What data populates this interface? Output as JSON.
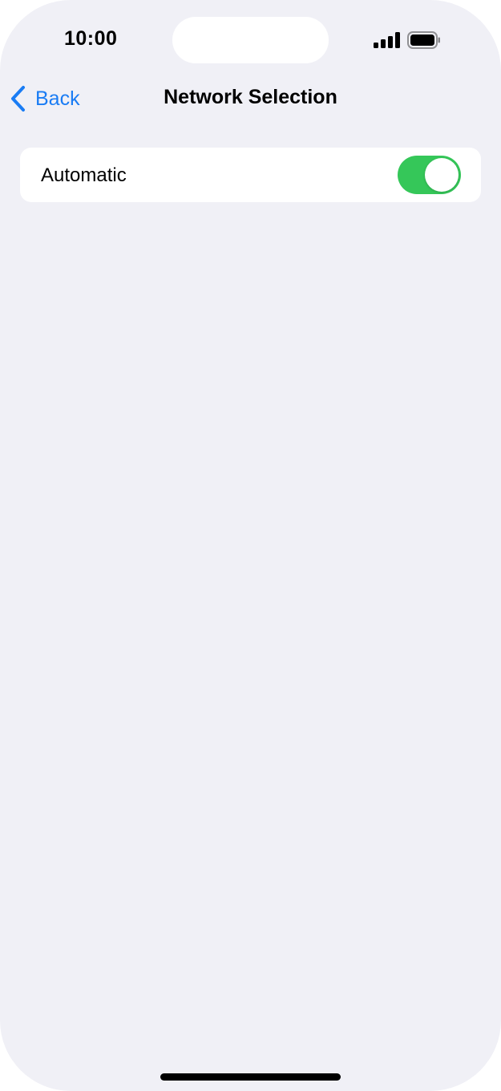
{
  "status_bar": {
    "time": "10:00",
    "signal_icon": "cellular-signal-icon",
    "signal_bars": 4,
    "battery_icon": "battery-icon",
    "battery_level": 1.0
  },
  "nav": {
    "back_label": "Back",
    "back_icon": "chevron-left-icon",
    "title": "Network Selection"
  },
  "settings": {
    "automatic": {
      "label": "Automatic",
      "enabled": true
    }
  },
  "colors": {
    "background": "#f0f0f6",
    "accent": "#1a7cf4",
    "toggle_on": "#35c759",
    "cell": "#ffffff"
  }
}
